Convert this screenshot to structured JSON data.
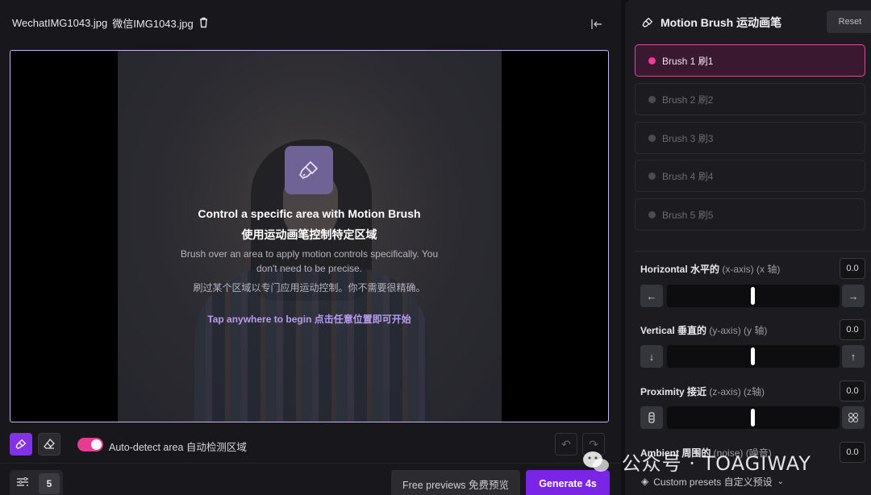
{
  "file": {
    "name": "WechatIMG1043.jpg",
    "name_cn": "微信IMG1043.jpg"
  },
  "canvas_hint": {
    "title": "Control a specific area with Motion Brush",
    "title_cn": "使用运动画笔控制特定区域",
    "description": "Brush over an area to apply motion controls specifically. You don't need to be precise.",
    "description_cn": "刷过某个区域以专门应用运动控制。你不需要很精确。",
    "tap": "Tap anywhere to begin 点击任意位置即可开始"
  },
  "toolbar": {
    "auto_detect_label": "Auto-detect area  自动检测区域",
    "auto_detect_on": true
  },
  "bottom": {
    "steps_value": "5",
    "free_previews": "Free previews  免费预览",
    "generate": "Generate 4s"
  },
  "panel": {
    "title": "Motion Brush 运动画笔",
    "reset": "Reset",
    "brushes": [
      {
        "label": "Brush 1 刷1",
        "active": true
      },
      {
        "label": "Brush 2 刷2",
        "active": false
      },
      {
        "label": "Brush 3 刷3",
        "active": false
      },
      {
        "label": "Brush 4 刷4",
        "active": false
      },
      {
        "label": "Brush 5 刷5",
        "active": false
      }
    ],
    "sliders": [
      {
        "label": "Horizontal 水平的",
        "sub": " (x-axis)  (x 轴)",
        "value": "0.0",
        "level": 0.5
      },
      {
        "label": "Vertical 垂直的",
        "sub": " (y-axis)  (y 轴)",
        "value": "0.0",
        "level": 0.5
      },
      {
        "label": "Proximity 接近",
        "sub": " (z-axis)  (z轴)",
        "value": "0.0",
        "level": 0.5
      },
      {
        "label": "Ambient 周围的",
        "sub": " (noise)  (噪音)",
        "value": "0.0"
      }
    ],
    "presets": "Custom presets 自定义预设"
  },
  "watermark": "公众号 · TOAGIWAY",
  "colors": {
    "accent_purple": "#7a24e6",
    "active_pink": "#ee3b98",
    "canvas_border": "#c9b3f2",
    "tap_text": "#b79cf2"
  }
}
